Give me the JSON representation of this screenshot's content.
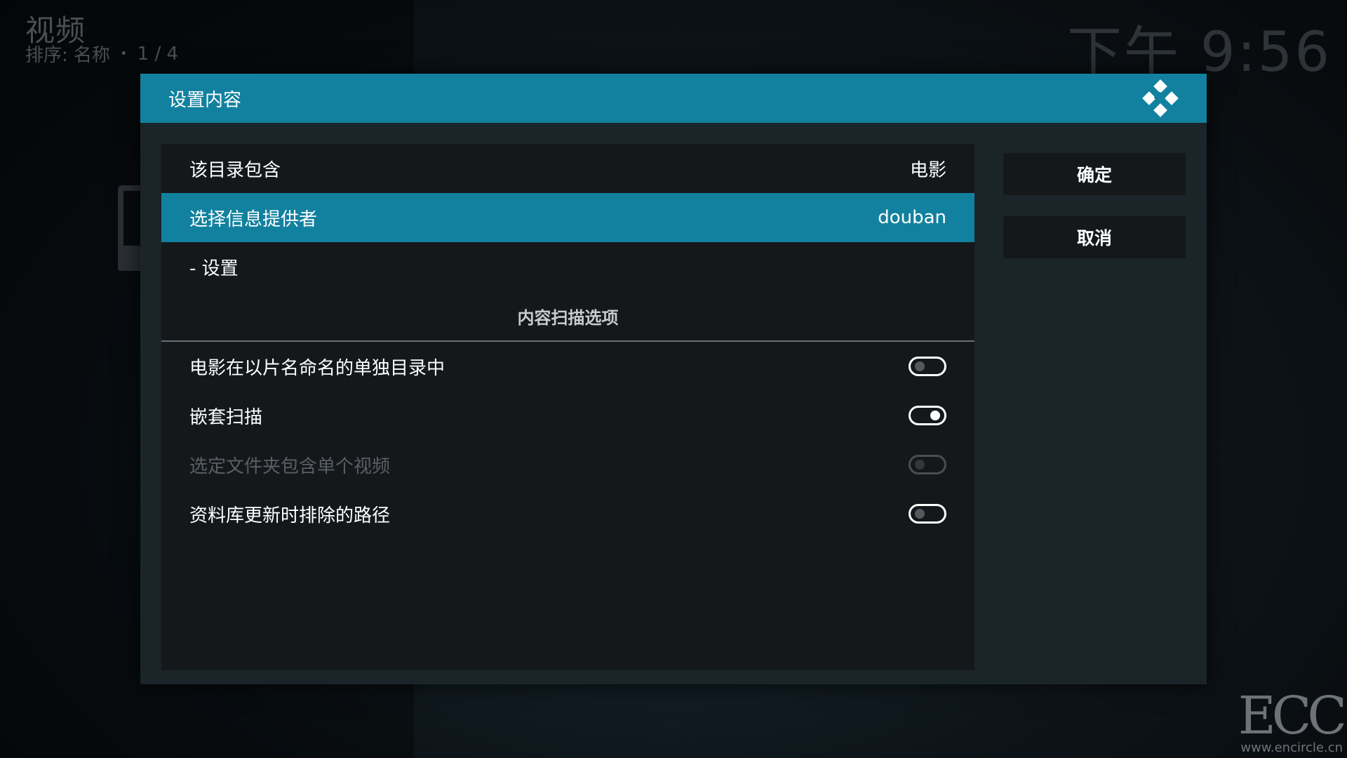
{
  "background": {
    "title": "视频",
    "sort_label": "排序: 名称",
    "dot": "•",
    "page": "1 / 4",
    "clock": "下午 9:56"
  },
  "dialog": {
    "title": "设置内容",
    "rows": [
      {
        "label": "该目录包含",
        "value": "电影"
      },
      {
        "label": "选择信息提供者",
        "value": "douban"
      },
      {
        "label": "- 设置",
        "value": ""
      }
    ],
    "section_heading": "内容扫描选项",
    "options": [
      {
        "label": "电影在以片名命名的单独目录中",
        "enabled": false
      },
      {
        "label": "嵌套扫描",
        "enabled": true
      },
      {
        "label": "选定文件夹包含单个视频",
        "enabled": false
      },
      {
        "label": "资料库更新时排除的路径",
        "enabled": false
      }
    ],
    "ok_label": "确定",
    "cancel_label": "取消"
  },
  "watermark": {
    "logo": "ECC",
    "url": "www.encircle.cn"
  },
  "colors": {
    "accent": "#12819f",
    "panel": "#14181b",
    "dialog": "#1b2428"
  }
}
